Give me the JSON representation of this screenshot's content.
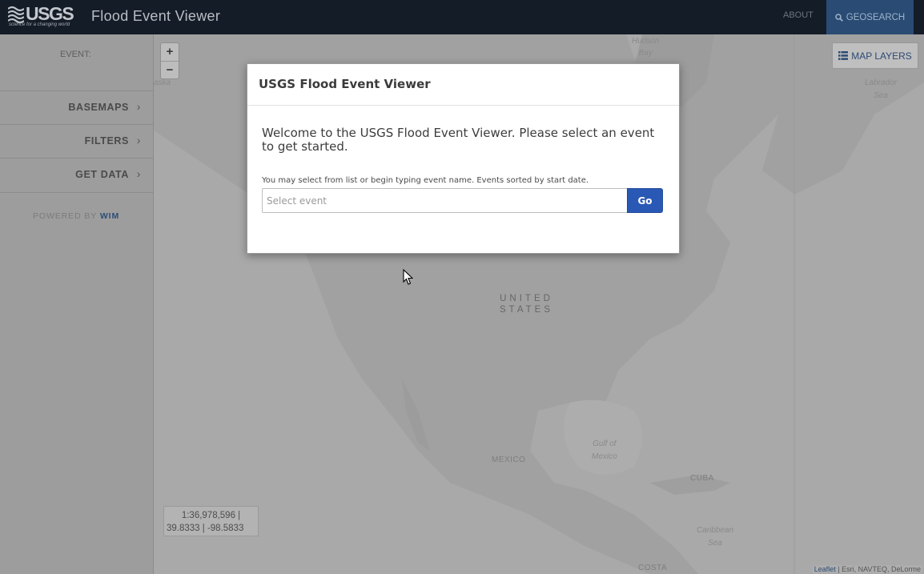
{
  "navbar": {
    "logo_text": "USGS",
    "logo_tagline": "science for a changing world",
    "title": "Flood Event Viewer",
    "about_label": "ABOUT",
    "geosearch_label": "GEOSEARCH",
    "geosearch_icon": "search-icon"
  },
  "sidebar": {
    "event_label": "EVENT:",
    "items": [
      {
        "label": "BASEMAPS",
        "icon": "chevron-right-icon"
      },
      {
        "label": "FILTERS",
        "icon": "chevron-right-icon"
      },
      {
        "label": "GET DATA",
        "icon": "chevron-right-icon"
      }
    ],
    "powered_by": "POWERED BY",
    "powered_by_link": "WIM"
  },
  "map": {
    "zoom_in": "+",
    "zoom_out": "−",
    "layers_label": "MAP LAYERS",
    "layers_icon": "list-icon",
    "scale_line1": "1:36,978,596 |",
    "scale_line2": "39.8333 | -98.5833",
    "attribution_link": "Leaflet",
    "attribution_text": " | Esri, NAVTEQ, DeLorme",
    "labels": {
      "hudson_bay_1": "Hudson",
      "hudson_bay_2": "Bay",
      "labrador_1": "Labrador",
      "labrador_2": "Sea",
      "us_1": "UNITED",
      "us_2": "STATES",
      "gulf_1": "Gulf of",
      "gulf_2": "Mexico",
      "mexico": "MEXICO",
      "cuba": "CUBA",
      "caribbean_1": "Caribbean",
      "caribbean_2": "Sea",
      "costa": "COSTA",
      "alaska_fragment": "aska"
    }
  },
  "modal": {
    "title": "USGS Flood Event Viewer",
    "welcome": "Welcome to the USGS Flood Event Viewer. Please select an event to get started.",
    "hint": "You may select from list or begin typing event name. Events sorted by start date.",
    "select_placeholder": "Select event",
    "go_label": "Go"
  },
  "colors": {
    "navbar_bg": "#141c28",
    "geosearch_bg": "#2a4b73",
    "go_button": "#2a58b5",
    "link": "#2d4e76"
  }
}
